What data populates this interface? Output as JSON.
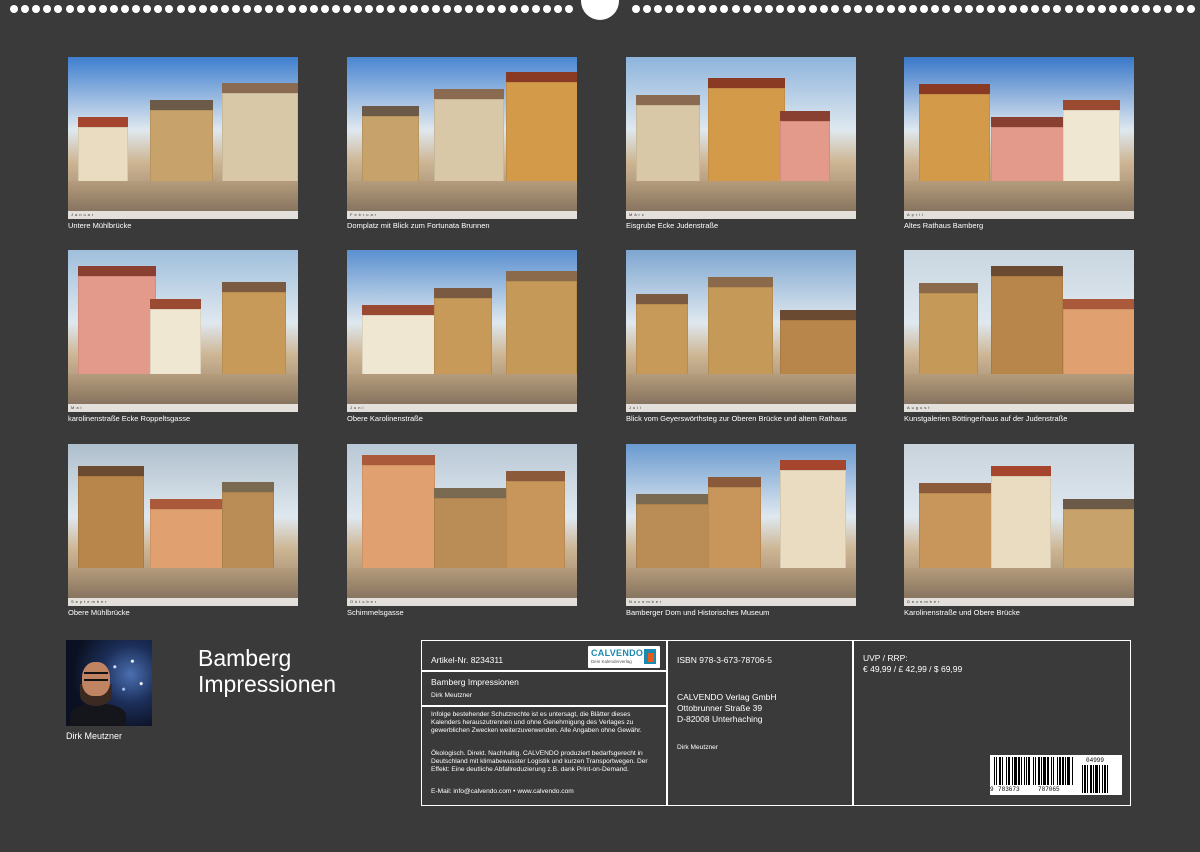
{
  "calendar": {
    "title_line1": "Bamberg",
    "title_line2": "Impressionen"
  },
  "months": [
    {
      "label": "Januar",
      "caption": "Untere Mühlbrücke"
    },
    {
      "label": "Februar",
      "caption": "Domplatz mit Blick zum Fortunata Brunnen"
    },
    {
      "label": "März",
      "caption": "Eisgrube Ecke Judenstraße"
    },
    {
      "label": "April",
      "caption": "Altes Rathaus Bamberg"
    },
    {
      "label": "Mai",
      "caption": "karolinenstraße Ecke Roppeltsgasse"
    },
    {
      "label": "Juni",
      "caption": "Obere Karolinenstraße"
    },
    {
      "label": "Juli",
      "caption": "Blick vom Geyerswörthsteg zur Oberen Brücke und altem Rathaus"
    },
    {
      "label": "August",
      "caption": "Kunstgalerien Böttingerhaus auf der Judenstraße"
    },
    {
      "label": "September",
      "caption": "Obere Mühlbrücke"
    },
    {
      "label": "Oktober",
      "caption": "Schimmelsgasse"
    },
    {
      "label": "November",
      "caption": "Bamberger Dom und Historisches Museum"
    },
    {
      "label": "Dezember",
      "caption": "Karolinenstraße und Obere Brücke"
    }
  ],
  "author": {
    "name": "Dirk Meutzner"
  },
  "product": {
    "article_label": "Artikel-Nr.",
    "article_number": "8234311",
    "title": "Bamberg Impressionen",
    "author": "Dirk Meutzner",
    "rights_text": "Infolge bestehender Schutzrechte ist es untersagt, die Blätter dieses Kalenders herauszutrennen und ohne Genehmigung des Verlages zu gewerblichen Zwecken weiterzuverwenden. Alle Angaben ohne Gewähr.",
    "eco_text": "Ökologisch. Direkt. Nachhaltig. CALVENDO produziert bedarfsgerecht in Deutschland mit klimabewusster Logistik und kurzen Transportwegen. Der Effekt: Eine deutliche Abfallreduzierung z.B. dank Print-on-Demand.",
    "contact": "E-Mail: info@calvendo.com • www.calvendo.com",
    "isbn": "ISBN 978-3-673-78706-5",
    "publisher_name": "CALVENDO Verlag GmbH",
    "publisher_street": "Ottobrunner Straße 39",
    "publisher_city": "D-82008 Unterhaching",
    "publisher_author": "Dirk Meutzner",
    "price_label": "UVP / RRP:",
    "price_values": "€ 49,99 / £ 42,99 / $ 69,99"
  },
  "logo": {
    "word": "CALVENDO",
    "tagline": "Dein Kalenderverlag"
  },
  "barcode": {
    "digits_first": "9",
    "digits_left": "783673",
    "digits_right": "787065",
    "addon": "04999"
  },
  "colors": {
    "background": "#3a3a3a",
    "text": "#ffffff",
    "logo_blue": "#1a8ab0",
    "logo_orange": "#e85b1c"
  }
}
